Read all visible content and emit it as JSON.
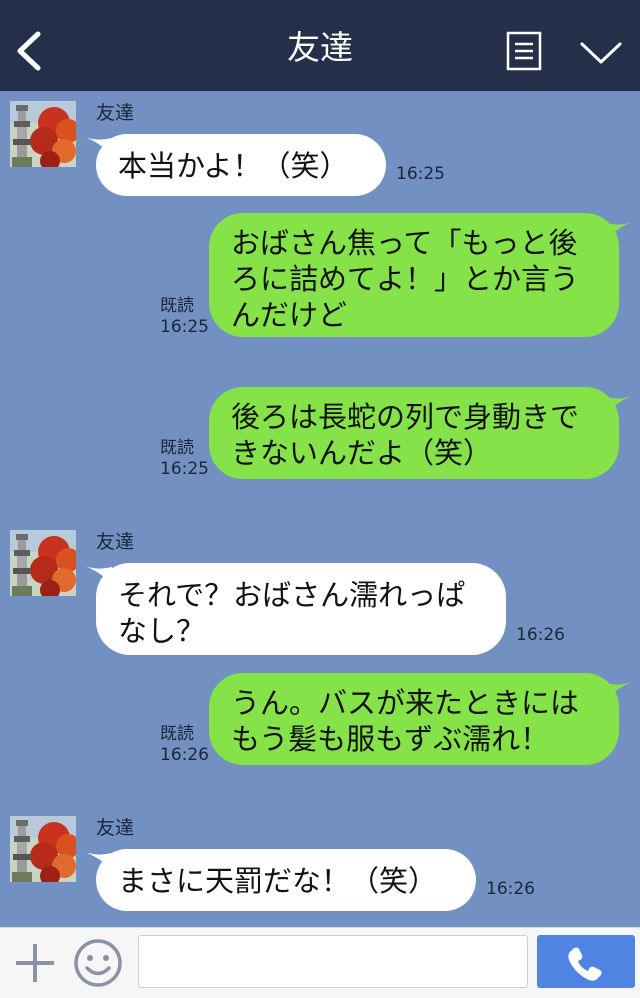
{
  "header": {
    "title": "友達",
    "back_icon": "chevron-left-icon",
    "menu_icon": "list-menu-icon",
    "collapse_icon": "chevron-down-icon"
  },
  "messages": [
    {
      "side": "left",
      "sender": "友達",
      "lines": [
        "本当かよ！（笑）"
      ],
      "time": "16:25"
    },
    {
      "side": "right",
      "read": "既読",
      "time": "16:25",
      "lines": [
        "おばさん焦って「もっと後",
        "ろに詰めてよ！」とか言う",
        "んだけど"
      ]
    },
    {
      "side": "right",
      "read": "既読",
      "time": "16:25",
      "lines": [
        "後ろは長蛇の列で身動きで",
        "きないんだよ（笑）"
      ]
    },
    {
      "side": "left",
      "sender": "友達",
      "lines": [
        "それで？おばさん濡れっぱ",
        "なし？"
      ],
      "time": "16:26"
    },
    {
      "side": "right",
      "read": "既読",
      "time": "16:26",
      "lines": [
        "うん。バスが来たときには",
        "もう髪も服もずぶ濡れ！"
      ]
    },
    {
      "side": "left",
      "sender": "友達",
      "lines": [
        "まさに天罰だな！（笑）"
      ],
      "time": "16:26"
    }
  ],
  "input": {
    "placeholder": "",
    "plus_icon": "plus-icon",
    "emoji_icon": "smiley-icon",
    "call_icon": "phone-icon"
  },
  "colors": {
    "header_bg": "#243049",
    "chat_bg": "#7291c2",
    "bubble_me": "#85e249",
    "bubble_them": "#ffffff",
    "call_button": "#4f84e3"
  }
}
